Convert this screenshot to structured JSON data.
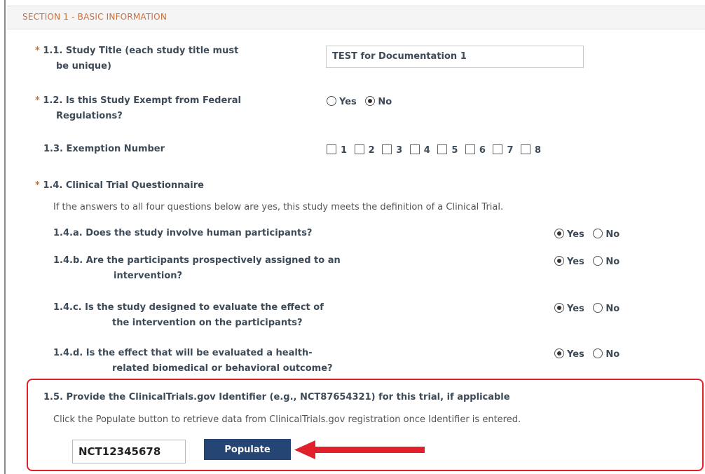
{
  "section_title": "SECTION 1 - BASIC INFORMATION",
  "required_marker": "*",
  "q1_1": {
    "label_line1": "1.1. Study Title (each study title must",
    "label_line2": "be unique)",
    "value": "TEST for Documentation 1"
  },
  "q1_2": {
    "label_line1": "1.2. Is this Study Exempt from Federal",
    "label_line2": "Regulations?",
    "yes": "Yes",
    "no": "No",
    "selected": "No"
  },
  "q1_3": {
    "label": "1.3. Exemption Number",
    "options": [
      "1",
      "2",
      "3",
      "4",
      "5",
      "6",
      "7",
      "8"
    ]
  },
  "q1_4": {
    "label": "1.4. Clinical Trial Questionnaire",
    "instructions": "If the answers to all four questions below are yes, this study meets the definition of a Clinical Trial.",
    "yes": "Yes",
    "no": "No",
    "a": {
      "line1": "1.4.a. Does the study involve human participants?",
      "selected": "Yes"
    },
    "b": {
      "line1": "1.4.b. Are the participants prospectively assigned to an",
      "line2": "intervention?",
      "selected": "Yes"
    },
    "c": {
      "line1": "1.4.c. Is the study designed to evaluate the effect of",
      "line2": "the intervention on the participants?",
      "selected": "Yes"
    },
    "d": {
      "line1": "1.4.d. Is the effect that will be evaluated a health-",
      "line2": "related biomedical or behavioral outcome?",
      "selected": "Yes"
    }
  },
  "q1_5": {
    "label": "1.5. Provide the ClinicalTrials.gov Identifier (e.g., NCT87654321) for this trial, if applicable",
    "help": "Click the Populate button to retrieve data from ClinicalTrials.gov registration once Identifier is entered.",
    "value": "NCT12345678",
    "button": "Populate"
  },
  "colors": {
    "accent": "#c96f3c",
    "button": "#254675",
    "highlight": "#e0202a"
  }
}
